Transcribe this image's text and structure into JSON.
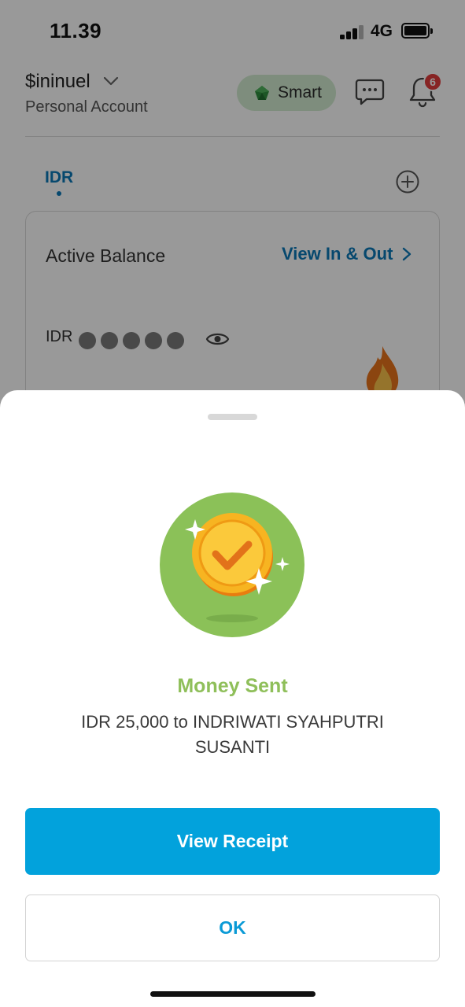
{
  "status_bar": {
    "time": "11.39",
    "network": "4G",
    "signal_bars_active": 3,
    "signal_bars_total": 4,
    "battery_level": 1.0
  },
  "header": {
    "account_name": "$ininuel",
    "account_type": "Personal Account",
    "plan_label": "Smart",
    "notification_count": "6",
    "icons": [
      "chevron-down-icon",
      "gem-icon",
      "chat-icon",
      "bell-icon"
    ]
  },
  "wallet_tabs": {
    "active": "IDR",
    "add_icon": "plus-circle-icon"
  },
  "balance_card": {
    "label": "Active Balance",
    "link_label": "View In & Out",
    "currency": "IDR",
    "masked_digits": 5,
    "visibility_icon": "eye-icon"
  },
  "sheet": {
    "title": "Money Sent",
    "message": "IDR 25,000 to INDRIWATI SYAHPUTRI SUSANTI",
    "primary_button": "View Receipt",
    "secondary_button": "OK",
    "illustration_icon": "coin-check-icon"
  },
  "colors": {
    "accent_blue": "#02a2dc",
    "link_blue": "#0a78b8",
    "success_green": "#8fbf5a",
    "illustration_green": "#8bc158",
    "coin_gold": "#f7b421",
    "badge_red": "#e23d3d",
    "overlay": "rgba(0,0,0,0.40)"
  }
}
